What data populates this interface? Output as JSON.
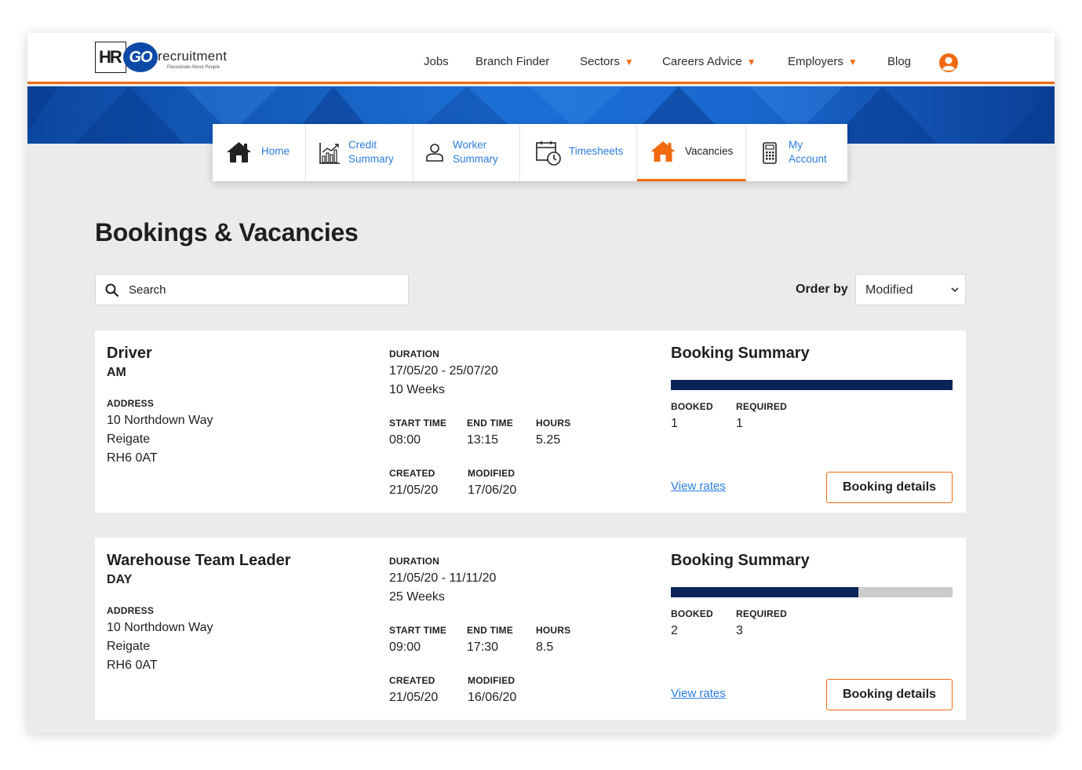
{
  "brand": {
    "logo_hr": "HR",
    "logo_go": "GO",
    "logo_word": "recruitment",
    "logo_tagline": "Passionate About People",
    "accent": "#f26a10",
    "link": "#2a7de1",
    "navy": "#0a2457",
    "banner_blue": "#1a68cf"
  },
  "topnav": [
    {
      "label": "Jobs",
      "dropdown": false
    },
    {
      "label": "Branch Finder",
      "dropdown": false
    },
    {
      "label": "Sectors",
      "dropdown": true
    },
    {
      "label": "Careers Advice",
      "dropdown": true
    },
    {
      "label": "Employers",
      "dropdown": true
    },
    {
      "label": "Blog",
      "dropdown": false
    }
  ],
  "user_icon": "user-circle-icon",
  "tabs": [
    {
      "label_line1": "Home",
      "label_line2": "",
      "icon": "home-icon",
      "active": false
    },
    {
      "label_line1": "Credit",
      "label_line2": "Summary",
      "icon": "bar-chart-icon",
      "active": false
    },
    {
      "label_line1": "Worker",
      "label_line2": "Summary",
      "icon": "person-icon",
      "active": false
    },
    {
      "label_line1": "Timesheets",
      "label_line2": "",
      "icon": "calendar-clock-icon",
      "active": false
    },
    {
      "label_line1": "Vacancies",
      "label_line2": "",
      "icon": "home-icon",
      "active": true
    },
    {
      "label_line1": "My",
      "label_line2": "Account",
      "icon": "calculator-icon",
      "active": false
    }
  ],
  "page_title": "Bookings & Vacancies",
  "search": {
    "placeholder": "Search",
    "value": ""
  },
  "order_by": {
    "label": "Order by",
    "selected": "Modified"
  },
  "labels": {
    "address": "ADDRESS",
    "duration": "DURATION",
    "start_time": "START TIME",
    "end_time": "END TIME",
    "hours": "HOURS",
    "created": "CREATED",
    "modified": "MODIFIED",
    "booking_summary": "Booking Summary",
    "booked": "BOOKED",
    "required": "REQUIRED",
    "view_rates": "View rates",
    "booking_details": "Booking details"
  },
  "bookings": [
    {
      "title": "Driver",
      "shift": "AM",
      "address": [
        "10 Northdown Way",
        "Reigate",
        "RH6 0AT"
      ],
      "date_range": "17/05/20 - 25/07/20",
      "weeks": "10 Weeks",
      "start_time": "08:00",
      "end_time": "13:15",
      "hours": "5.25",
      "created": "21/05/20",
      "modified": "17/06/20",
      "booked": "1",
      "required": "1",
      "fill_fraction": 1.0
    },
    {
      "title": "Warehouse Team Leader",
      "shift": "DAY",
      "address": [
        "10 Northdown Way",
        "Reigate",
        "RH6 0AT"
      ],
      "date_range": "21/05/20 - 11/11/20",
      "weeks": "25 Weeks",
      "start_time": "09:00",
      "end_time": "17:30",
      "hours": "8.5",
      "created": "21/05/20",
      "modified": "16/06/20",
      "booked": "2",
      "required": "3",
      "fill_fraction": 0.667
    }
  ]
}
